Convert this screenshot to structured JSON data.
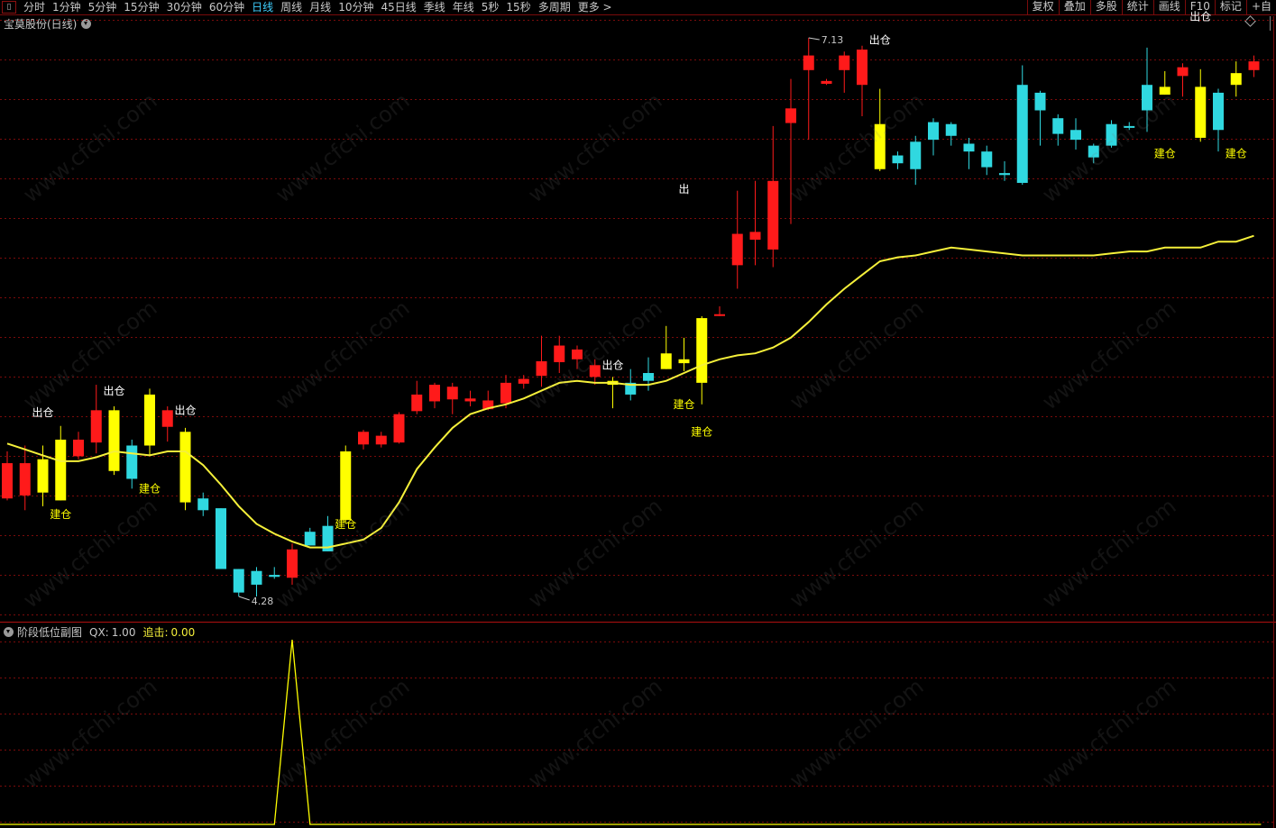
{
  "toolbar": {
    "items": [
      "分时",
      "1分钟",
      "5分钟",
      "15分钟",
      "30分钟",
      "60分钟",
      "日线",
      "周线",
      "月线",
      "10分钟",
      "45日线",
      "季线",
      "年线",
      "5秒",
      "15秒",
      "多周期",
      "更多 >"
    ],
    "active": "日线",
    "right_buttons": [
      "复权",
      "叠加",
      "多股",
      "统计",
      "画线",
      "F10",
      "标记",
      "+自"
    ]
  },
  "chart_title": "宝莫股份(日线)",
  "price_high_label": "7.13",
  "price_low_label": "4.28",
  "labels": {
    "buy": "建仓",
    "sell": "出仓",
    "sell_partial": "出"
  },
  "indicator": {
    "name": "阶段低位副图",
    "qx_label": "QX:",
    "qx_value": "1.00",
    "chase_label": "追击:",
    "chase_value": "0.00"
  },
  "watermark": "www.cfchi.com",
  "colors": {
    "up": "#ff1a1a",
    "down": "#30d8e0",
    "signal": "#ffff00",
    "ma": "#f5f03a",
    "grid": "#7a0b0b",
    "divider": "#b01010"
  },
  "chart_data": {
    "type": "candlestick",
    "candles": [
      {
        "o": 4.96,
        "c": 4.78,
        "h": 5.02,
        "l": 4.77,
        "k": "up"
      },
      {
        "o": 4.8,
        "c": 4.96,
        "h": 5.05,
        "l": 4.72,
        "k": "up"
      },
      {
        "o": 4.98,
        "c": 4.81,
        "h": 5.05,
        "l": 4.74,
        "k": "sig"
      },
      {
        "o": 4.77,
        "c": 5.08,
        "h": 5.15,
        "l": 4.77,
        "k": "sig"
      },
      {
        "o": 5.0,
        "c": 5.08,
        "h": 5.12,
        "l": 4.98,
        "k": "up"
      },
      {
        "o": 5.07,
        "c": 5.23,
        "h": 5.36,
        "l": 5.01,
        "k": "up"
      },
      {
        "o": 5.23,
        "c": 4.92,
        "h": 5.25,
        "l": 4.9,
        "k": "sig"
      },
      {
        "o": 5.05,
        "c": 4.88,
        "h": 5.08,
        "l": 4.83,
        "k": "down"
      },
      {
        "o": 5.05,
        "c": 5.31,
        "h": 5.34,
        "l": 5.0,
        "k": "sig"
      },
      {
        "o": 5.15,
        "c": 5.23,
        "h": 5.25,
        "l": 5.07,
        "k": "up"
      },
      {
        "o": 5.12,
        "c": 4.76,
        "h": 5.14,
        "l": 4.72,
        "k": "sig"
      },
      {
        "o": 4.78,
        "c": 4.72,
        "h": 4.81,
        "l": 4.69,
        "k": "down"
      },
      {
        "o": 4.73,
        "c": 4.42,
        "h": 4.73,
        "l": 4.42,
        "k": "down"
      },
      {
        "o": 4.42,
        "c": 4.3,
        "h": 4.42,
        "l": 4.28,
        "k": "down"
      },
      {
        "o": 4.41,
        "c": 4.34,
        "h": 4.43,
        "l": 4.28,
        "k": "down"
      },
      {
        "o": 4.39,
        "c": 4.38,
        "h": 4.43,
        "l": 4.37,
        "k": "down"
      },
      {
        "o": 4.38,
        "c": 4.52,
        "h": 4.55,
        "l": 4.34,
        "k": "up"
      },
      {
        "o": 4.54,
        "c": 4.61,
        "h": 4.63,
        "l": 4.54,
        "k": "down"
      },
      {
        "o": 4.64,
        "c": 4.51,
        "h": 4.69,
        "l": 4.51,
        "k": "down"
      },
      {
        "o": 4.67,
        "c": 5.02,
        "h": 5.05,
        "l": 4.65,
        "k": "sig"
      },
      {
        "o": 5.06,
        "c": 5.12,
        "h": 5.13,
        "l": 5.03,
        "k": "up"
      },
      {
        "o": 5.06,
        "c": 5.1,
        "h": 5.12,
        "l": 5.04,
        "k": "up"
      },
      {
        "o": 5.07,
        "c": 5.21,
        "h": 5.22,
        "l": 5.06,
        "k": "up"
      },
      {
        "o": 5.23,
        "c": 5.31,
        "h": 5.38,
        "l": 5.21,
        "k": "up"
      },
      {
        "o": 5.28,
        "c": 5.36,
        "h": 5.37,
        "l": 5.24,
        "k": "up"
      },
      {
        "o": 5.29,
        "c": 5.35,
        "h": 5.37,
        "l": 5.21,
        "k": "up"
      },
      {
        "o": 5.28,
        "c": 5.29,
        "h": 5.33,
        "l": 5.25,
        "k": "up"
      },
      {
        "o": 5.24,
        "c": 5.28,
        "h": 5.33,
        "l": 5.23,
        "k": "up"
      },
      {
        "o": 5.27,
        "c": 5.37,
        "h": 5.41,
        "l": 5.24,
        "k": "up"
      },
      {
        "o": 5.37,
        "c": 5.39,
        "h": 5.41,
        "l": 5.34,
        "k": "up"
      },
      {
        "o": 5.41,
        "c": 5.48,
        "h": 5.61,
        "l": 5.35,
        "k": "up"
      },
      {
        "o": 5.48,
        "c": 5.56,
        "h": 5.61,
        "l": 5.42,
        "k": "up"
      },
      {
        "o": 5.54,
        "c": 5.49,
        "h": 5.56,
        "l": 5.44,
        "k": "up"
      },
      {
        "o": 5.46,
        "c": 5.4,
        "h": 5.49,
        "l": 5.36,
        "k": "up"
      },
      {
        "o": 5.38,
        "c": 5.36,
        "h": 5.4,
        "l": 5.24,
        "k": "sig"
      },
      {
        "o": 5.37,
        "c": 5.31,
        "h": 5.44,
        "l": 5.28,
        "k": "down"
      },
      {
        "o": 5.42,
        "c": 5.38,
        "h": 5.5,
        "l": 5.33,
        "k": "down"
      },
      {
        "o": 5.44,
        "c": 5.52,
        "h": 5.66,
        "l": 5.44,
        "k": "sig"
      },
      {
        "o": 5.49,
        "c": 5.47,
        "h": 5.6,
        "l": 5.43,
        "k": "sig"
      },
      {
        "o": 5.7,
        "c": 5.37,
        "h": 5.71,
        "l": 5.26,
        "k": "sig"
      },
      {
        "o": 5.72,
        "c": 5.72,
        "h": 5.76,
        "l": 5.71,
        "k": "up"
      },
      {
        "o": 6.13,
        "c": 5.97,
        "h": 6.35,
        "l": 5.85,
        "k": "up"
      },
      {
        "o": 6.14,
        "c": 6.1,
        "h": 6.4,
        "l": 5.97,
        "k": "up"
      },
      {
        "o": 6.4,
        "c": 6.05,
        "h": 6.68,
        "l": 5.96,
        "k": "up"
      },
      {
        "o": 6.7,
        "c": 6.77,
        "h": 6.92,
        "l": 6.18,
        "k": "up"
      },
      {
        "o": 6.97,
        "c": 7.04,
        "h": 7.13,
        "l": 6.61,
        "k": "up"
      },
      {
        "o": 6.9,
        "c": 6.91,
        "h": 6.92,
        "l": 6.89,
        "k": "up"
      },
      {
        "o": 6.97,
        "c": 7.04,
        "h": 7.06,
        "l": 6.85,
        "k": "up"
      },
      {
        "o": 7.07,
        "c": 6.89,
        "h": 7.09,
        "l": 6.73,
        "k": "up"
      },
      {
        "o": 6.69,
        "c": 6.46,
        "h": 6.87,
        "l": 6.45,
        "k": "sig"
      },
      {
        "o": 6.53,
        "c": 6.49,
        "h": 6.55,
        "l": 6.46,
        "k": "down"
      },
      {
        "o": 6.6,
        "c": 6.46,
        "h": 6.63,
        "l": 6.38,
        "k": "down"
      },
      {
        "o": 6.61,
        "c": 6.7,
        "h": 6.72,
        "l": 6.53,
        "k": "down"
      },
      {
        "o": 6.69,
        "c": 6.63,
        "h": 6.7,
        "l": 6.58,
        "k": "down"
      },
      {
        "o": 6.59,
        "c": 6.55,
        "h": 6.62,
        "l": 6.46,
        "k": "down"
      },
      {
        "o": 6.55,
        "c": 6.47,
        "h": 6.58,
        "l": 6.43,
        "k": "down"
      },
      {
        "o": 6.44,
        "c": 6.43,
        "h": 6.5,
        "l": 6.4,
        "k": "down"
      },
      {
        "o": 6.89,
        "c": 6.39,
        "h": 6.99,
        "l": 6.38,
        "k": "down"
      },
      {
        "o": 6.85,
        "c": 6.76,
        "h": 6.86,
        "l": 6.58,
        "k": "down"
      },
      {
        "o": 6.72,
        "c": 6.64,
        "h": 6.74,
        "l": 6.58,
        "k": "down"
      },
      {
        "o": 6.66,
        "c": 6.61,
        "h": 6.72,
        "l": 6.56,
        "k": "down"
      },
      {
        "o": 6.58,
        "c": 6.52,
        "h": 6.59,
        "l": 6.49,
        "k": "down"
      },
      {
        "o": 6.69,
        "c": 6.58,
        "h": 6.71,
        "l": 6.57,
        "k": "down"
      },
      {
        "o": 6.68,
        "c": 6.68,
        "h": 6.7,
        "l": 6.66,
        "k": "down"
      },
      {
        "o": 6.76,
        "c": 6.89,
        "h": 7.08,
        "l": 6.65,
        "k": "down"
      },
      {
        "o": 6.88,
        "c": 6.84,
        "h": 6.96,
        "l": 6.84,
        "k": "sig"
      },
      {
        "o": 6.94,
        "c": 6.98,
        "h": 7.0,
        "l": 6.83,
        "k": "up"
      },
      {
        "o": 6.88,
        "c": 6.62,
        "h": 6.97,
        "l": 6.6,
        "k": "sig"
      },
      {
        "o": 6.66,
        "c": 6.85,
        "h": 6.87,
        "l": 6.55,
        "k": "down"
      },
      {
        "o": 6.95,
        "c": 6.89,
        "h": 7.01,
        "l": 6.83,
        "k": "sig"
      },
      {
        "o": 6.97,
        "c": 7.01,
        "h": 7.04,
        "l": 6.93,
        "k": "up"
      }
    ],
    "ma": [
      5.06,
      5.03,
      5.0,
      4.97,
      4.97,
      4.99,
      5.02,
      5.01,
      5.0,
      5.02,
      5.02,
      4.95,
      4.85,
      4.74,
      4.65,
      4.6,
      4.56,
      4.53,
      4.53,
      4.55,
      4.57,
      4.63,
      4.76,
      4.93,
      5.04,
      5.14,
      5.21,
      5.24,
      5.26,
      5.29,
      5.33,
      5.37,
      5.38,
      5.37,
      5.37,
      5.36,
      5.36,
      5.38,
      5.42,
      5.46,
      5.49,
      5.51,
      5.52,
      5.55,
      5.6,
      5.68,
      5.77,
      5.85,
      5.92,
      5.99,
      6.01,
      6.02,
      6.04,
      6.06,
      6.05,
      6.04,
      6.03,
      6.02,
      6.02,
      6.02,
      6.02,
      6.02,
      6.03,
      6.04,
      6.04,
      6.06,
      6.06,
      6.06,
      6.09,
      6.09,
      6.12
    ],
    "ylim": [
      4.28,
      7.13
    ],
    "buy_signals": [
      {
        "i": 3,
        "yv": 4.68
      },
      {
        "i": 8,
        "yv": 4.81
      },
      {
        "i": 19,
        "yv": 4.63
      },
      {
        "i": 38,
        "yv": 5.24
      },
      {
        "i": 39,
        "yv": 5.1
      },
      {
        "i": 65,
        "yv": 6.52
      },
      {
        "i": 69,
        "yv": 6.52
      }
    ],
    "sell_signals": [
      {
        "i": 2,
        "yv": 5.2,
        "t": "sell"
      },
      {
        "i": 6,
        "yv": 5.31,
        "t": "sell"
      },
      {
        "i": 10,
        "yv": 5.21,
        "t": "sell"
      },
      {
        "i": 34,
        "yv": 5.44,
        "t": "sell"
      },
      {
        "i": 49,
        "yv": 7.1,
        "t": "sell"
      },
      {
        "i": 38,
        "yv": 6.34,
        "t": "sell_partial"
      },
      {
        "i": 67,
        "yv": 7.22,
        "t": "sell"
      }
    ],
    "sub": {
      "x": [
        0,
        15,
        16,
        17,
        70
      ],
      "y": [
        0,
        0,
        1,
        0,
        0
      ],
      "ylim": [
        0,
        1
      ]
    }
  }
}
